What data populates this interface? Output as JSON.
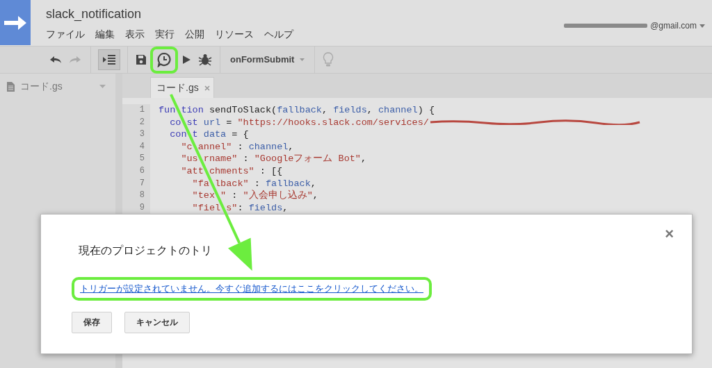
{
  "project": {
    "title": "slack_notification",
    "account": "@gmail.com"
  },
  "menu": [
    "ファイル",
    "編集",
    "表示",
    "実行",
    "公開",
    "リソース",
    "ヘルプ"
  ],
  "toolbar": [
    {
      "kind": "undo",
      "disabled": false,
      "pressed": false,
      "highlighted": false
    },
    {
      "kind": "redo",
      "disabled": true,
      "pressed": false,
      "highlighted": false
    },
    {
      "kind": "indent",
      "disabled": false,
      "pressed": true,
      "highlighted": false
    },
    {
      "kind": "save",
      "disabled": false,
      "pressed": false,
      "highlighted": false
    },
    {
      "kind": "triggers",
      "disabled": false,
      "pressed": false,
      "highlighted": true
    },
    {
      "kind": "run",
      "disabled": false,
      "pressed": false,
      "highlighted": false
    },
    {
      "kind": "debug",
      "disabled": false,
      "pressed": false,
      "highlighted": false
    },
    {
      "kind": "function-select",
      "label": "onFormSubmit",
      "pressed": false,
      "highlighted": false
    },
    {
      "kind": "tip",
      "disabled": true,
      "pressed": false,
      "highlighted": false
    }
  ],
  "sidebar": {
    "files": [
      {
        "name": "コード.gs"
      }
    ]
  },
  "tabs": [
    {
      "label": "コード.gs",
      "selected": true
    }
  ],
  "code": [
    {
      "number": "1",
      "tokens": [
        {
          "kind": "keyword",
          "text": "fun"
        },
        {
          "kind": "keyword",
          "text": "tion",
          "covered_before": true
        },
        {
          "kind": "plain",
          "text": " sendToSlack("
        },
        {
          "kind": "variable",
          "text": "fallback"
        },
        {
          "kind": "plain",
          "text": ", "
        },
        {
          "kind": "variable",
          "text": "fields"
        },
        {
          "kind": "plain",
          "text": ", "
        },
        {
          "kind": "variable",
          "text": "channel"
        },
        {
          "kind": "plain",
          "text": ") {"
        }
      ]
    },
    {
      "number": "2",
      "tokens": [
        {
          "kind": "keyword",
          "text": "  co"
        },
        {
          "kind": "keyword",
          "text": "st ",
          "covered_before": true
        },
        {
          "kind": "variable",
          "text": "url"
        },
        {
          "kind": "plain",
          "text": " = "
        },
        {
          "kind": "string",
          "text": "\"https://hooks.slack.com/services/"
        },
        {
          "kind": "redacted"
        }
      ]
    },
    {
      "number": "3",
      "tokens": [
        {
          "kind": "keyword",
          "text": "  con"
        },
        {
          "kind": "keyword",
          "text": "t ",
          "covered_before": true
        },
        {
          "kind": "variable",
          "text": "data"
        },
        {
          "kind": "plain",
          "text": " = {"
        }
      ]
    },
    {
      "number": "4",
      "tokens": [
        {
          "kind": "string",
          "text": "    \"c"
        },
        {
          "kind": "string",
          "text": "annel\"",
          "covered_before": true
        },
        {
          "kind": "plain",
          "text": " : "
        },
        {
          "kind": "variable",
          "text": "channel"
        },
        {
          "kind": "plain",
          "text": ","
        }
      ]
    },
    {
      "number": "5",
      "tokens": [
        {
          "kind": "string",
          "text": "    \"us"
        },
        {
          "kind": "string",
          "text": "rname\"",
          "covered_before": true
        },
        {
          "kind": "plain",
          "text": " : "
        },
        {
          "kind": "string",
          "text": "\"Googleフォーム Bot\""
        },
        {
          "kind": "plain",
          "text": ","
        }
      ]
    },
    {
      "number": "6",
      "tokens": [
        {
          "kind": "string",
          "text": "    \"att"
        },
        {
          "kind": "string",
          "text": "chments\"",
          "covered_before": true
        },
        {
          "kind": "plain",
          "text": " : [{"
        }
      ]
    },
    {
      "number": "7",
      "tokens": [
        {
          "kind": "string",
          "text": "      \"fa"
        },
        {
          "kind": "string",
          "text": "lback\"",
          "covered_before": true
        },
        {
          "kind": "plain",
          "text": " : "
        },
        {
          "kind": "variable",
          "text": "fallback"
        },
        {
          "kind": "plain",
          "text": ","
        }
      ]
    },
    {
      "number": "8",
      "tokens": [
        {
          "kind": "string",
          "text": "      \"tex"
        },
        {
          "kind": "string",
          "text": "\"",
          "covered_before": true
        },
        {
          "kind": "plain",
          "text": " : "
        },
        {
          "kind": "string",
          "text": "\"入会申し込み\""
        },
        {
          "kind": "plain",
          "text": ","
        }
      ]
    },
    {
      "number": "9",
      "tokens": [
        {
          "kind": "string",
          "text": "      \"fiel"
        },
        {
          "kind": "string",
          "text": "s\"",
          "covered_before": true
        },
        {
          "kind": "plain",
          "text": ": "
        },
        {
          "kind": "variable",
          "text": "fields"
        },
        {
          "kind": "plain",
          "text": ","
        }
      ]
    }
  ],
  "dialog": {
    "title": "現在のプロジェクトのトリ",
    "close": "×",
    "link": {
      "text": "トリガーが設定されていません。今すぐ追加するにはここをクリックしてください。",
      "highlighted": true
    },
    "buttons": [
      "保存",
      "キャンセル"
    ]
  }
}
